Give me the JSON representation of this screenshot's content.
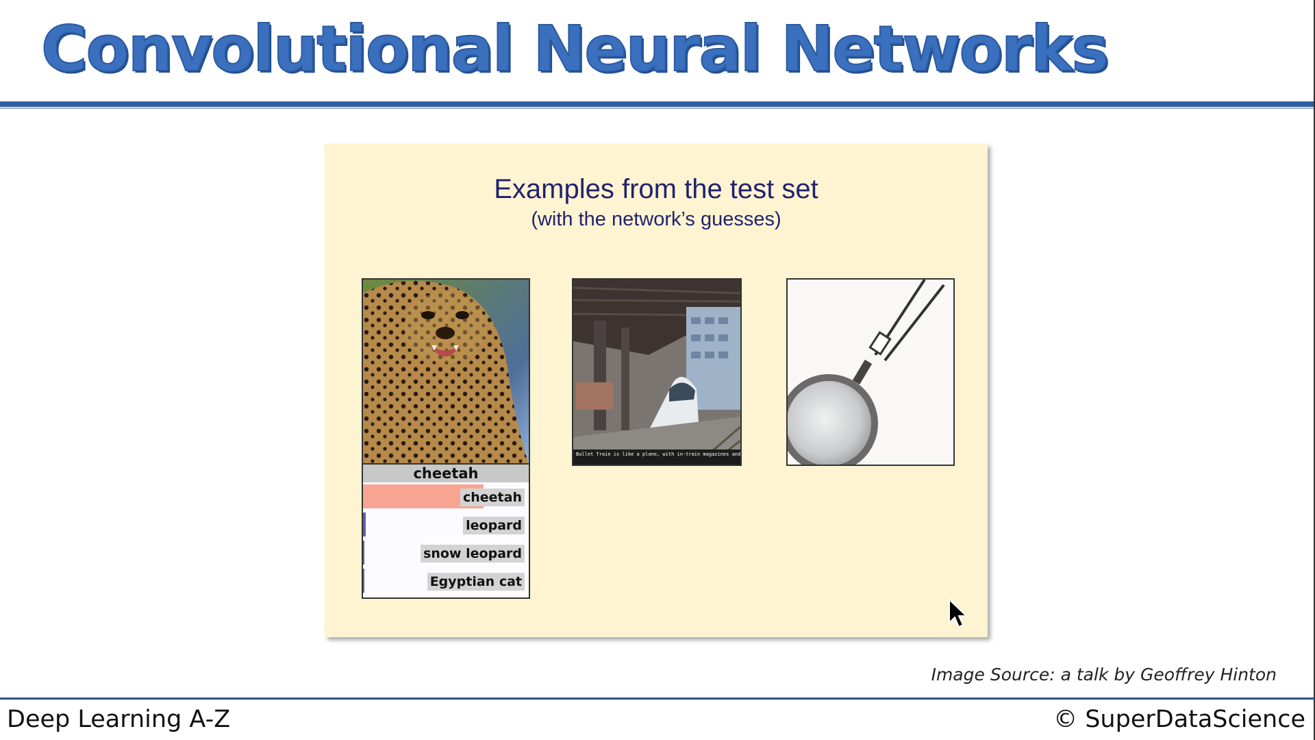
{
  "header": {
    "title": "Convolutional Neural Networks"
  },
  "slide": {
    "title": "Examples from the test set",
    "subtitle": "(with the network’s guesses)",
    "images": [
      {
        "icon": "cheetah-photo",
        "prediction": "cheetah",
        "guesses": [
          {
            "label": "cheetah",
            "score": 0.9
          },
          {
            "label": "leopard",
            "score": 0.02
          },
          {
            "label": "snow leopard",
            "score": 0.005
          },
          {
            "label": "Egyptian cat",
            "score": 0.005
          }
        ]
      },
      {
        "icon": "bullet-train-photo",
        "caption": "Bullet Train is like a plane, with in-train magazines and a ... that you can plug your headphones into and listen to"
      },
      {
        "icon": "hand-glass-photo"
      }
    ],
    "colors": {
      "background": "#fff4d2",
      "title": "#22226e",
      "top_guess_bar": "#f7a492"
    }
  },
  "source_note": "Image Source: a talk by Geoffrey Hinton",
  "footer": {
    "left": "Deep Learning A-Z",
    "right": "© SuperDataScience"
  },
  "colors": {
    "title": "#3a70be",
    "rule": "#2f5f9e"
  }
}
